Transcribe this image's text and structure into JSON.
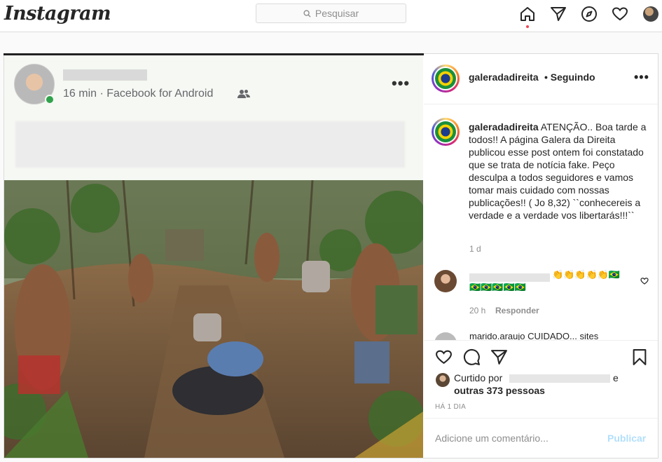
{
  "header": {
    "logo": "Instagram",
    "search_placeholder": "Pesquisar",
    "icons": [
      "home-icon",
      "direct-icon",
      "explore-icon",
      "activity-heart-icon",
      "profile-avatar"
    ]
  },
  "embedded_post": {
    "meta": "16 min · Facebook for Android",
    "icons": [
      "more-icon",
      "friends-icon"
    ]
  },
  "post": {
    "username": "galeradadireita",
    "separator": "•",
    "follow_state": "Seguindo",
    "caption_user": "galeradadireita",
    "caption_text": "ATENÇÃO.. Boa tarde a todos!! A página Galera da Direita publicou esse post ontem foi constatado que se trata de notícia fake. Peço desculpa a todos seguidores e vamos tomar mais cuidado com nossas publicações!! ( Jo 8,32) ``conhecereis a verdade e a verdade vos libertarás!!!``",
    "caption_time": "1 d",
    "comment": {
      "text_suffix": "👏👏👏👏👏🇧🇷",
      "text_line2": "🇧🇷🇧🇷🇧🇷🇧🇷🇧🇷",
      "time": "20 h",
      "reply": "Responder"
    },
    "comment2_partial": "marido.araujo CUIDADO... sites",
    "likes_prefix": "Curtido por",
    "likes_e": "e",
    "likes_others": "outras 373 pessoas",
    "ago": "HÁ 1 DIA",
    "comment_placeholder": "Adicione um comentário...",
    "publish": "Publicar"
  },
  "colors": {
    "accent_blue_disabled": "#b2dffc",
    "notification_dot": "#ed4956",
    "secondary_text": "#8e8e8e",
    "border": "#dbdbdb"
  }
}
